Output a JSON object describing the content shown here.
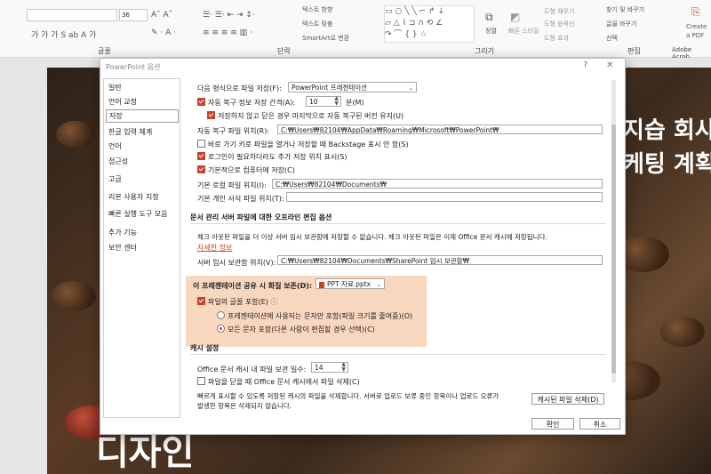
{
  "ribbon": {
    "groups": [
      "글꼴",
      "단락",
      "그리기",
      "편집"
    ],
    "para_tools": [
      "텍스트 방향",
      "텍스트 맞춤",
      "SmartArt로 변환"
    ],
    "draw_tools": [
      "정렬",
      "빠른 스타일",
      "도형 채우기",
      "도형 윤곽선",
      "도형 효과"
    ],
    "edit_tools": [
      "찾기 및 바꾸기",
      "글꼴 바꾸기",
      "선택"
    ],
    "pdf": [
      "Create",
      "a PDF",
      "Adobe Acrob"
    ],
    "font_size": "36"
  },
  "slide": {
    "line1": "지습 회사",
    "line2": "케팅 계획",
    "line3": "디자인"
  },
  "dialog": {
    "title": "PowerPoint 옵션",
    "help": "?",
    "close": "✕",
    "nav": [
      "일반",
      "언어 교정",
      "저장",
      "한글 입력 체계",
      "언어",
      "접근성",
      "고급",
      "리본 사용자 지정",
      "빠른 실행 도구 모음",
      "추가 기능",
      "보안 센터"
    ],
    "nav_selected": "저장",
    "save": {
      "format_label": "다음 형식으로 파일 저장(F):",
      "format_value": "PowerPoint 프레젠테이션",
      "autorecover_label": "자동 복구 정보 저장 간격(A):",
      "autorecover_value": "10",
      "autorecover_unit": "분(M)",
      "keep_last_label": "저장하지 않고 닫은 경우 마지막으로 자동 복구된 버전 유지(U)",
      "autorecover_loc_label": "자동 복구 파일 위치(R):",
      "autorecover_loc_value": "C:₩Users₩82104₩AppData₩Roaming₩Microsoft₩PowerPoint₩",
      "backstage_label": "바로 가기 키로 파일을 열거나 저장할 때 Backstage 표시 안 함(S)",
      "signin_label": "로그인이 필요하더라도 추가 저장 위치 표시(S)",
      "default_pc_label": "기본적으로 컴퓨터에 저장(C)",
      "local_loc_label": "기본 로컬 파일 위치(I):",
      "local_loc_value": "C:₩Users₩82104₩Documents₩",
      "template_loc_label": "기본 개인 서식 파일 위치(T):",
      "template_loc_value": ""
    },
    "offline": {
      "header": "문서 관리 서버 파일에 대한 오프라인 편집 옵션",
      "desc": "체크 아웃된 파일을 더 이상 서버 임시 보관함에 저장할 수 없습니다. 체크 아웃된 파일은 이제 Office 문서 캐시에 저장됩니다.",
      "more_info": "자세한 정보",
      "drafts_label": "서버 임시 보관함 위치(V):",
      "drafts_value": "C:₩Users₩82104₩Documents₩SharePoint 임시 보관함₩"
    },
    "fidelity": {
      "header": "이 프레젠테이션 공유 시 화질 보존(D):",
      "file": "PPT 자료.pptx",
      "embed_label": "파일의 글꼴 포함(E)",
      "info": "ⓘ",
      "opt1": "프레젠테이션에 사용되는 문자만 포함(파일 크기를 줄여줌)(O)",
      "opt2": "모든 문자 포함(다른 사람이 편집할 경우 선택)(C)"
    },
    "cache": {
      "header": "캐시 설정",
      "days_label": "Office 문서 캐시 내 파일 보관 일수:",
      "days_value": "14",
      "delete_on_close_label": "파일을 닫을 때 Office 문서 캐시에서 파일 삭제(C)",
      "desc1": "빠르게 표시할 수 있도록 저장된 캐시의 파일을 삭제합니다. 서버로 업로드 보류 중인 항목이나 업로드 오류가",
      "desc2": "발생한 항목은 삭제되지 않습니다.",
      "delete_button": "캐시된 파일 삭제(D)"
    },
    "ok": "확인",
    "cancel": "취소"
  }
}
